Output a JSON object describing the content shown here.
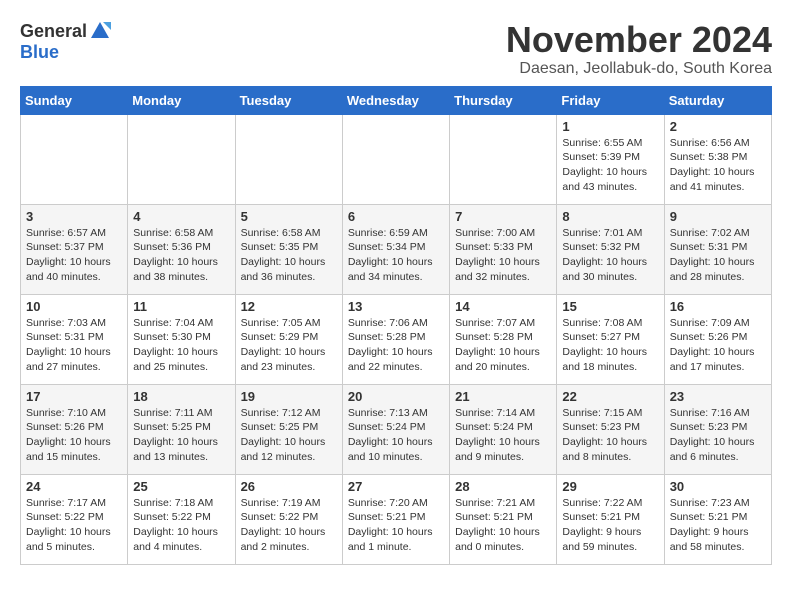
{
  "logo": {
    "general": "General",
    "blue": "Blue"
  },
  "title": "November 2024",
  "subtitle": "Daesan, Jeollabuk-do, South Korea",
  "days_of_week": [
    "Sunday",
    "Monday",
    "Tuesday",
    "Wednesday",
    "Thursday",
    "Friday",
    "Saturday"
  ],
  "weeks": [
    [
      {
        "day": "",
        "info": ""
      },
      {
        "day": "",
        "info": ""
      },
      {
        "day": "",
        "info": ""
      },
      {
        "day": "",
        "info": ""
      },
      {
        "day": "",
        "info": ""
      },
      {
        "day": "1",
        "info": "Sunrise: 6:55 AM\nSunset: 5:39 PM\nDaylight: 10 hours\nand 43 minutes."
      },
      {
        "day": "2",
        "info": "Sunrise: 6:56 AM\nSunset: 5:38 PM\nDaylight: 10 hours\nand 41 minutes."
      }
    ],
    [
      {
        "day": "3",
        "info": "Sunrise: 6:57 AM\nSunset: 5:37 PM\nDaylight: 10 hours\nand 40 minutes."
      },
      {
        "day": "4",
        "info": "Sunrise: 6:58 AM\nSunset: 5:36 PM\nDaylight: 10 hours\nand 38 minutes."
      },
      {
        "day": "5",
        "info": "Sunrise: 6:58 AM\nSunset: 5:35 PM\nDaylight: 10 hours\nand 36 minutes."
      },
      {
        "day": "6",
        "info": "Sunrise: 6:59 AM\nSunset: 5:34 PM\nDaylight: 10 hours\nand 34 minutes."
      },
      {
        "day": "7",
        "info": "Sunrise: 7:00 AM\nSunset: 5:33 PM\nDaylight: 10 hours\nand 32 minutes."
      },
      {
        "day": "8",
        "info": "Sunrise: 7:01 AM\nSunset: 5:32 PM\nDaylight: 10 hours\nand 30 minutes."
      },
      {
        "day": "9",
        "info": "Sunrise: 7:02 AM\nSunset: 5:31 PM\nDaylight: 10 hours\nand 28 minutes."
      }
    ],
    [
      {
        "day": "10",
        "info": "Sunrise: 7:03 AM\nSunset: 5:31 PM\nDaylight: 10 hours\nand 27 minutes."
      },
      {
        "day": "11",
        "info": "Sunrise: 7:04 AM\nSunset: 5:30 PM\nDaylight: 10 hours\nand 25 minutes."
      },
      {
        "day": "12",
        "info": "Sunrise: 7:05 AM\nSunset: 5:29 PM\nDaylight: 10 hours\nand 23 minutes."
      },
      {
        "day": "13",
        "info": "Sunrise: 7:06 AM\nSunset: 5:28 PM\nDaylight: 10 hours\nand 22 minutes."
      },
      {
        "day": "14",
        "info": "Sunrise: 7:07 AM\nSunset: 5:28 PM\nDaylight: 10 hours\nand 20 minutes."
      },
      {
        "day": "15",
        "info": "Sunrise: 7:08 AM\nSunset: 5:27 PM\nDaylight: 10 hours\nand 18 minutes."
      },
      {
        "day": "16",
        "info": "Sunrise: 7:09 AM\nSunset: 5:26 PM\nDaylight: 10 hours\nand 17 minutes."
      }
    ],
    [
      {
        "day": "17",
        "info": "Sunrise: 7:10 AM\nSunset: 5:26 PM\nDaylight: 10 hours\nand 15 minutes."
      },
      {
        "day": "18",
        "info": "Sunrise: 7:11 AM\nSunset: 5:25 PM\nDaylight: 10 hours\nand 13 minutes."
      },
      {
        "day": "19",
        "info": "Sunrise: 7:12 AM\nSunset: 5:25 PM\nDaylight: 10 hours\nand 12 minutes."
      },
      {
        "day": "20",
        "info": "Sunrise: 7:13 AM\nSunset: 5:24 PM\nDaylight: 10 hours\nand 10 minutes."
      },
      {
        "day": "21",
        "info": "Sunrise: 7:14 AM\nSunset: 5:24 PM\nDaylight: 10 hours\nand 9 minutes."
      },
      {
        "day": "22",
        "info": "Sunrise: 7:15 AM\nSunset: 5:23 PM\nDaylight: 10 hours\nand 8 minutes."
      },
      {
        "day": "23",
        "info": "Sunrise: 7:16 AM\nSunset: 5:23 PM\nDaylight: 10 hours\nand 6 minutes."
      }
    ],
    [
      {
        "day": "24",
        "info": "Sunrise: 7:17 AM\nSunset: 5:22 PM\nDaylight: 10 hours\nand 5 minutes."
      },
      {
        "day": "25",
        "info": "Sunrise: 7:18 AM\nSunset: 5:22 PM\nDaylight: 10 hours\nand 4 minutes."
      },
      {
        "day": "26",
        "info": "Sunrise: 7:19 AM\nSunset: 5:22 PM\nDaylight: 10 hours\nand 2 minutes."
      },
      {
        "day": "27",
        "info": "Sunrise: 7:20 AM\nSunset: 5:21 PM\nDaylight: 10 hours\nand 1 minute."
      },
      {
        "day": "28",
        "info": "Sunrise: 7:21 AM\nSunset: 5:21 PM\nDaylight: 10 hours\nand 0 minutes."
      },
      {
        "day": "29",
        "info": "Sunrise: 7:22 AM\nSunset: 5:21 PM\nDaylight: 9 hours\nand 59 minutes."
      },
      {
        "day": "30",
        "info": "Sunrise: 7:23 AM\nSunset: 5:21 PM\nDaylight: 9 hours\nand 58 minutes."
      }
    ]
  ]
}
